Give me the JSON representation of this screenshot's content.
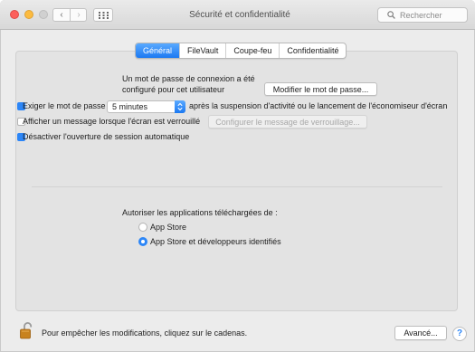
{
  "window": {
    "title": "Sécurité et confidentialité",
    "search_placeholder": "Rechercher",
    "nav_back": "‹",
    "nav_forward": "›"
  },
  "tabs": [
    {
      "label": "Général",
      "active": true
    },
    {
      "label": "FileVault",
      "active": false
    },
    {
      "label": "Coupe-feu",
      "active": false
    },
    {
      "label": "Confidentialité",
      "active": false
    }
  ],
  "general": {
    "password_set_line1": "Un mot de passe de connexion a été",
    "password_set_line2": "configuré pour cet utilisateur",
    "change_password_button": "Modifier le mot de passe...",
    "require_password_label": "Exiger le mot de passe",
    "require_password_checked": true,
    "require_password_delay": "5 minutes",
    "require_password_suffix": "après la suspension d'activité ou le lancement de l'économiseur d'écran",
    "show_message_label": "Afficher un message lorsque l'écran est verrouillé",
    "show_message_checked": false,
    "set_lock_message_button": "Configurer le message de verrouillage...",
    "disable_auto_login_label": "Désactiver l'ouverture de session automatique",
    "disable_auto_login_checked": true
  },
  "downloads": {
    "heading": "Autoriser les applications téléchargées de :",
    "options": [
      {
        "label": "App Store",
        "selected": false
      },
      {
        "label": "App Store et développeurs identifiés",
        "selected": true
      }
    ]
  },
  "footer": {
    "lock_text": "Pour empêcher les modifications, cliquez sur le cadenas.",
    "advanced_button": "Avancé...",
    "help_label": "?"
  },
  "colors": {
    "accent": "#2c86f7"
  }
}
